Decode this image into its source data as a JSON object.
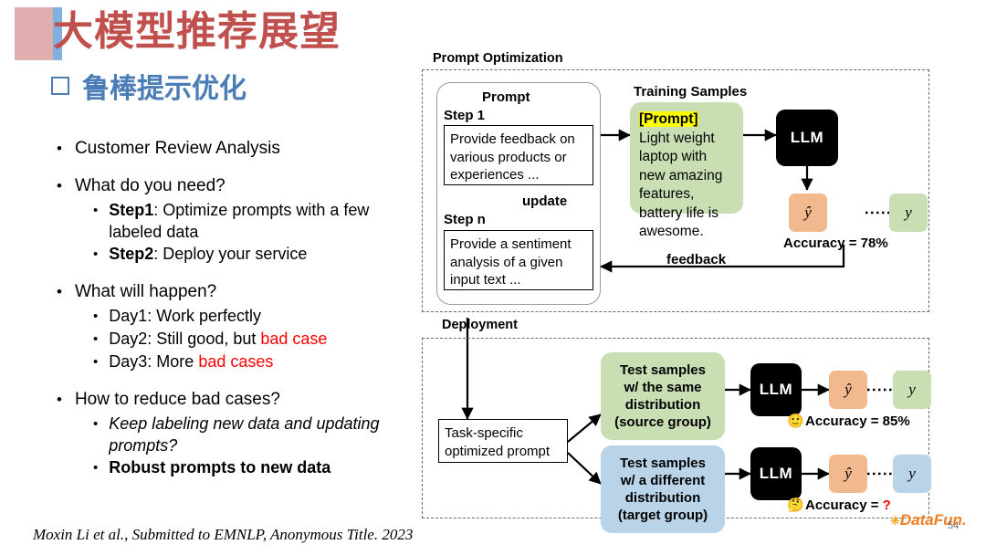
{
  "title": {
    "main": "大模型推荐展望",
    "subtitle": "鲁棒提示优化",
    "marker_icon": "empty-square-bullet-icon",
    "accent_red": "#c0504d",
    "accent_blue": "#4a7db5",
    "block_pink": "#e0aeae",
    "block_blue": "#7fb0e0"
  },
  "bullets": [
    {
      "level1": "Customer Review Analysis",
      "children": []
    },
    {
      "level1": "What do you need?",
      "children": [
        {
          "bold": "Step1",
          "rest": ": Optimize prompts with a few labeled data"
        },
        {
          "bold": "Step2",
          "rest": ": Deploy your service"
        }
      ]
    },
    {
      "level1": "What will happen?",
      "children": [
        {
          "plain": "Day1: Work perfectly"
        },
        {
          "plain": "Day2: Still good, but ",
          "red": "bad case"
        },
        {
          "plain": "Day3: More ",
          "red": "bad cases"
        }
      ]
    },
    {
      "level1": "How to reduce bad cases?",
      "children": [
        {
          "italic": "Keep labeling new data and updating prompts?"
        },
        {
          "strong": "Robust prompts to new data"
        }
      ]
    }
  ],
  "citation": "Moxin Li et al., Submitted to EMNLP, Anonymous Title. 2023",
  "diagram": {
    "section_prompt_optimization": "Prompt Optimization",
    "section_deployment": "Deployment",
    "prompt_panel": {
      "heading": "Prompt",
      "step1_label": "Step 1",
      "step1_text": "Provide feedback on various products or experiences ...",
      "update_label": "update",
      "stepn_label": "Step n",
      "stepn_text": "Provide a sentiment analysis of a given input text ..."
    },
    "training_samples": {
      "heading": "Training Samples",
      "prompt_tag": "[Prompt]",
      "sample_text": "Light weight laptop with new amazing features, battery life is awesome."
    },
    "llm_label": "LLM",
    "yhat_label": "ŷ",
    "y_label": "y",
    "accuracy_train": "Accuracy = 78%",
    "feedback_label": "feedback",
    "task_prompt_box": "Task-specific optimized prompt",
    "test_source": "Test samples\nw/ the same\ndistribution\n(source group)",
    "test_source_lines": [
      "Test samples",
      "w/ the same",
      "distribution",
      "(source group)"
    ],
    "test_target_lines": [
      "Test samples",
      "w/ a different",
      "distribution",
      "(target group)"
    ],
    "accuracy_source": "Accuracy = 85%",
    "accuracy_target_prefix": "Accuracy = ",
    "accuracy_target_value": "?",
    "emoji_happy": "🙂",
    "emoji_thinking": "🤔",
    "colors": {
      "green": "#c9dfb3",
      "blue": "#b9d4e9",
      "orange": "#f2b88e",
      "highlight": "#ffff00",
      "llm_black": "#000000",
      "dashed_border": "#6b6b6b"
    }
  },
  "footer": {
    "logo_text": "DataFun.",
    "logo_star_icon": "sparkle-icon",
    "page_number": "54"
  }
}
